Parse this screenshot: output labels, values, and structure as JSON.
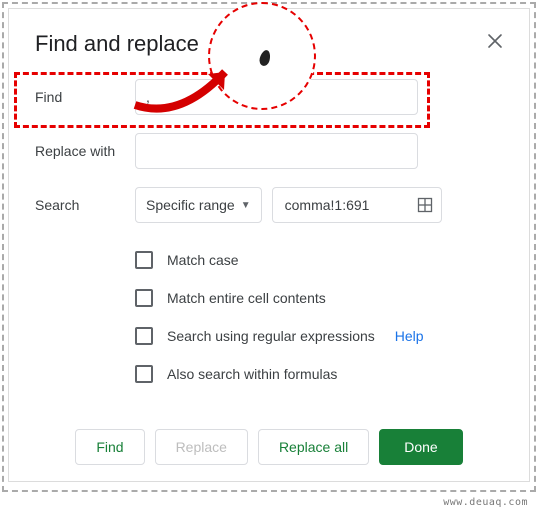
{
  "dialog": {
    "title": "Find and replace",
    "find_label": "Find",
    "find_value": ",",
    "replace_label": "Replace with",
    "replace_value": "",
    "search_label": "Search",
    "scope_selected": "Specific range",
    "range_value": "comma!1:691",
    "options": {
      "match_case": "Match case",
      "match_entire": "Match entire cell contents",
      "regex": "Search using regular expressions",
      "help": "Help",
      "formulas": "Also search within formulas"
    },
    "buttons": {
      "find": "Find",
      "replace": "Replace",
      "replace_all": "Replace all",
      "done": "Done"
    }
  },
  "watermark": "www.deuaq.com"
}
